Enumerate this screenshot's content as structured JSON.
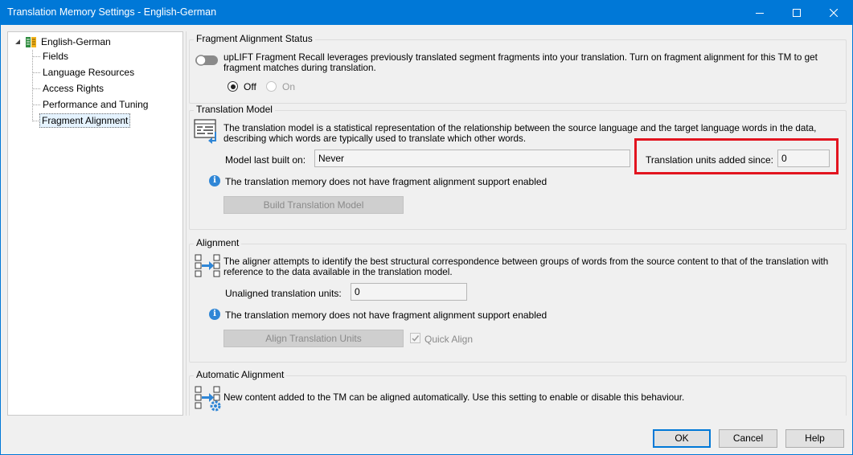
{
  "window": {
    "title": "Translation Memory Settings - English-German"
  },
  "tree": {
    "root_label": "English-German",
    "items": [
      {
        "label": "Fields"
      },
      {
        "label": "Language Resources"
      },
      {
        "label": "Access Rights"
      },
      {
        "label": "Performance and Tuning"
      },
      {
        "label": "Fragment Alignment",
        "selected": true
      }
    ]
  },
  "fragment_status": {
    "title": "Fragment Alignment Status",
    "description": "upLIFT Fragment Recall leverages previously translated segment fragments into your translation. Turn on fragment alignment for this TM to get fragment matches during translation.",
    "off_label": "Off",
    "on_label": "On",
    "selected": "Off"
  },
  "translation_model": {
    "title": "Translation Model",
    "description": "The translation model is a statistical representation of the relationship between the source language and the target language words in the data, describing which words are typically used to translate which other words.",
    "last_built_label": "Model last built on:",
    "last_built_value": "Never",
    "units_added_label": "Translation units added since:",
    "units_added_value": "0",
    "info_text": "The translation memory does not have fragment alignment support enabled",
    "build_button": "Build Translation Model"
  },
  "alignment": {
    "title": "Alignment",
    "description": "The aligner attempts to identify the best structural correspondence between groups of words from the source content to that of the translation with reference to the data available in the translation model.",
    "unaligned_label": "Unaligned translation units:",
    "unaligned_value": "0",
    "info_text": "The translation memory does not have fragment alignment support enabled",
    "align_button": "Align Translation Units",
    "quick_align_label": "Quick Align"
  },
  "auto_alignment": {
    "title": "Automatic Alignment",
    "description": "New content added to the TM can be aligned automatically. Use this setting to enable or disable this behaviour."
  },
  "footer": {
    "ok": "OK",
    "cancel": "Cancel",
    "help": "Help"
  },
  "colors": {
    "titlebar": "#0078d7",
    "highlight": "#e2141f",
    "info": "#2f86d6"
  }
}
